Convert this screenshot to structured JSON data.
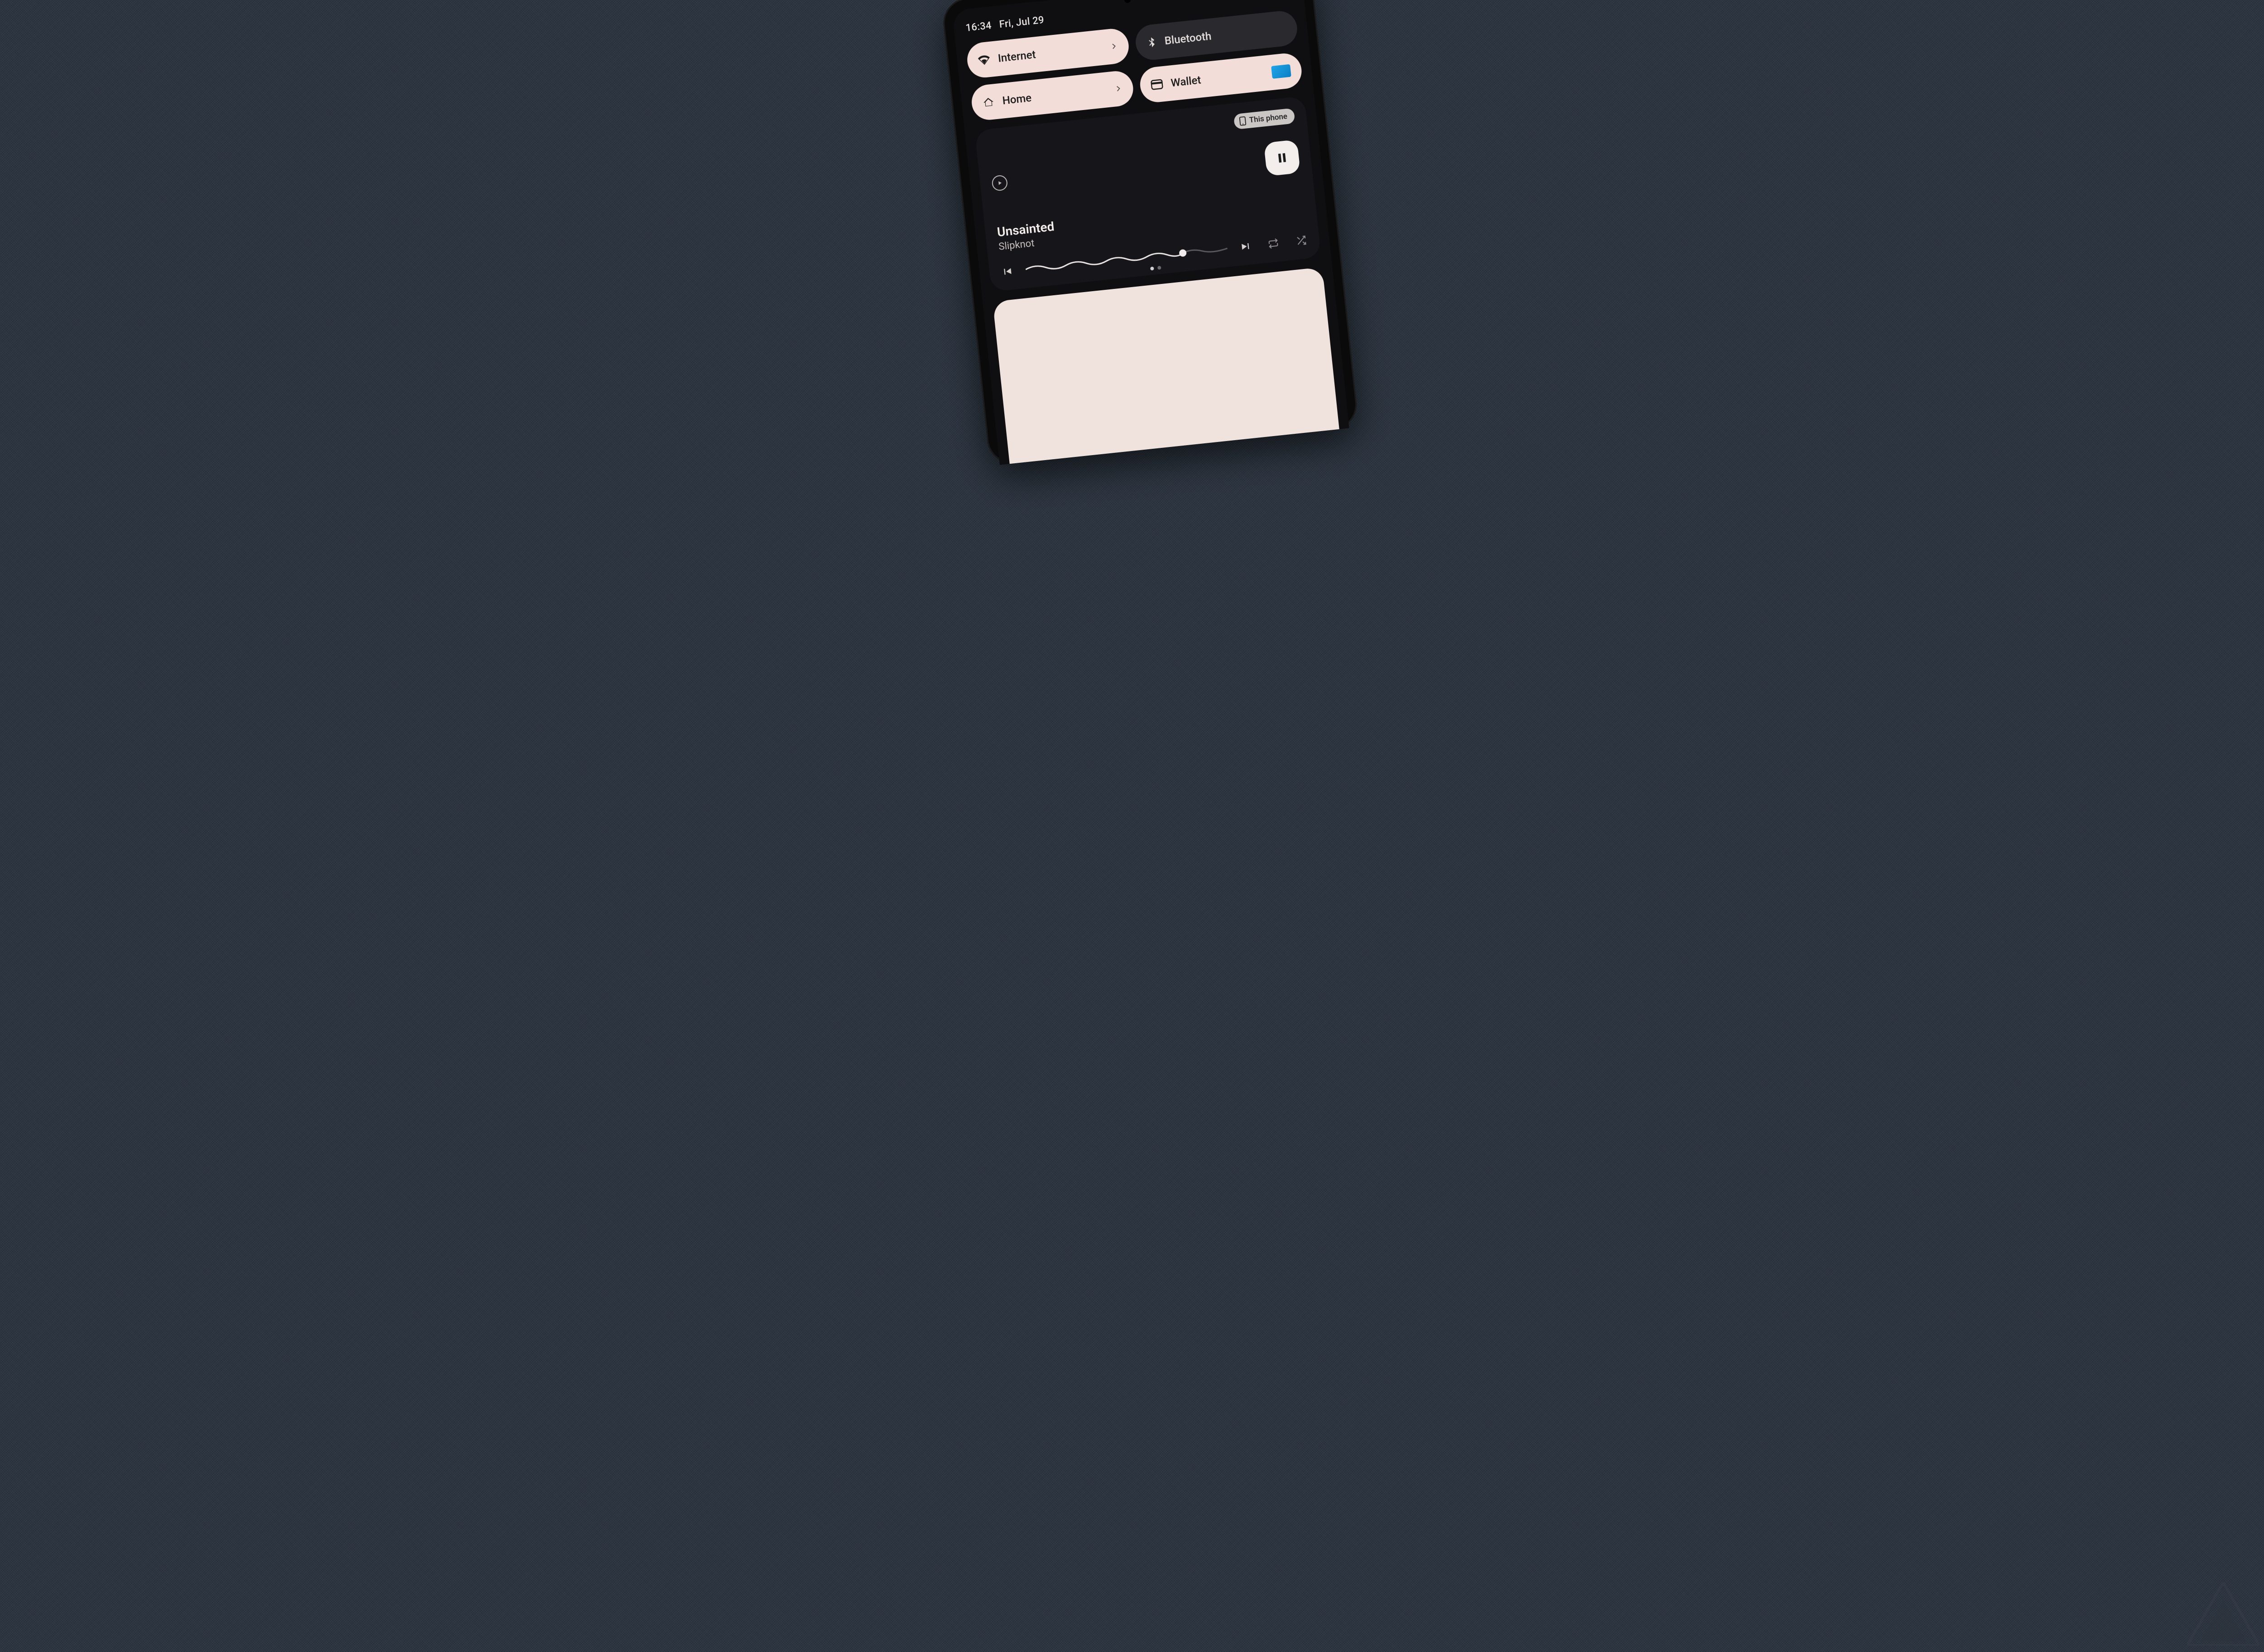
{
  "status": {
    "time": "16:34",
    "date": "Fri, Jul 29"
  },
  "tiles": {
    "internet": {
      "label": "Internet",
      "active": true,
      "has_chevron": true
    },
    "bluetooth": {
      "label": "Bluetooth",
      "active": false
    },
    "home": {
      "label": "Home",
      "active": true,
      "has_chevron": true
    },
    "wallet": {
      "label": "Wallet",
      "active": true,
      "has_card": true
    }
  },
  "media": {
    "output_device": "This phone",
    "track_title": "Unsainted",
    "track_artist": "Slipknot",
    "playing": true,
    "progress_fraction": 0.78
  },
  "colors": {
    "tile_active_bg": "#f2ddd8",
    "tile_inactive_bg": "#2a2a2e",
    "panel_bg": "#0f0f12",
    "notif_bg": "#f0e3de"
  }
}
